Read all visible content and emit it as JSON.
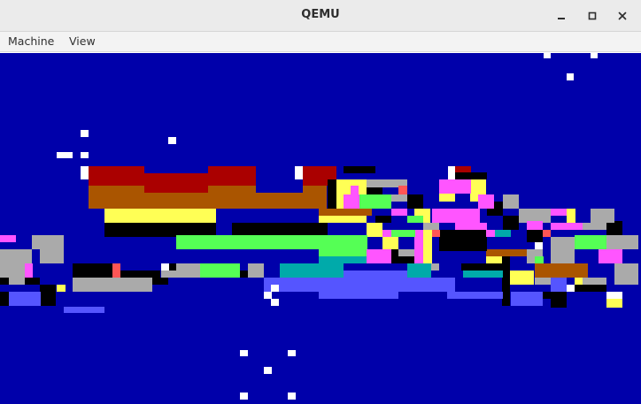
{
  "window": {
    "title": "QEMU",
    "controls": {
      "minimize_icon": "minimize-icon",
      "maximize_icon": "maximize-icon",
      "close_icon": "close-icon"
    }
  },
  "menubar": {
    "items": [
      {
        "label": "Machine"
      },
      {
        "label": "View"
      }
    ]
  },
  "vm_display": {
    "background_color": "#0000aa",
    "palette": {
      "black": "#000000",
      "dark_red": "#aa0000",
      "brown": "#aa5500",
      "yellow": "#ffff55",
      "light_green": "#55ff55",
      "cyan": "#00aaaa",
      "light_blue": "#5555ff",
      "gray": "#aaaaaa",
      "magenta": "#ff55ff",
      "light_red": "#ff5555",
      "white": "#ffffff"
    }
  }
}
